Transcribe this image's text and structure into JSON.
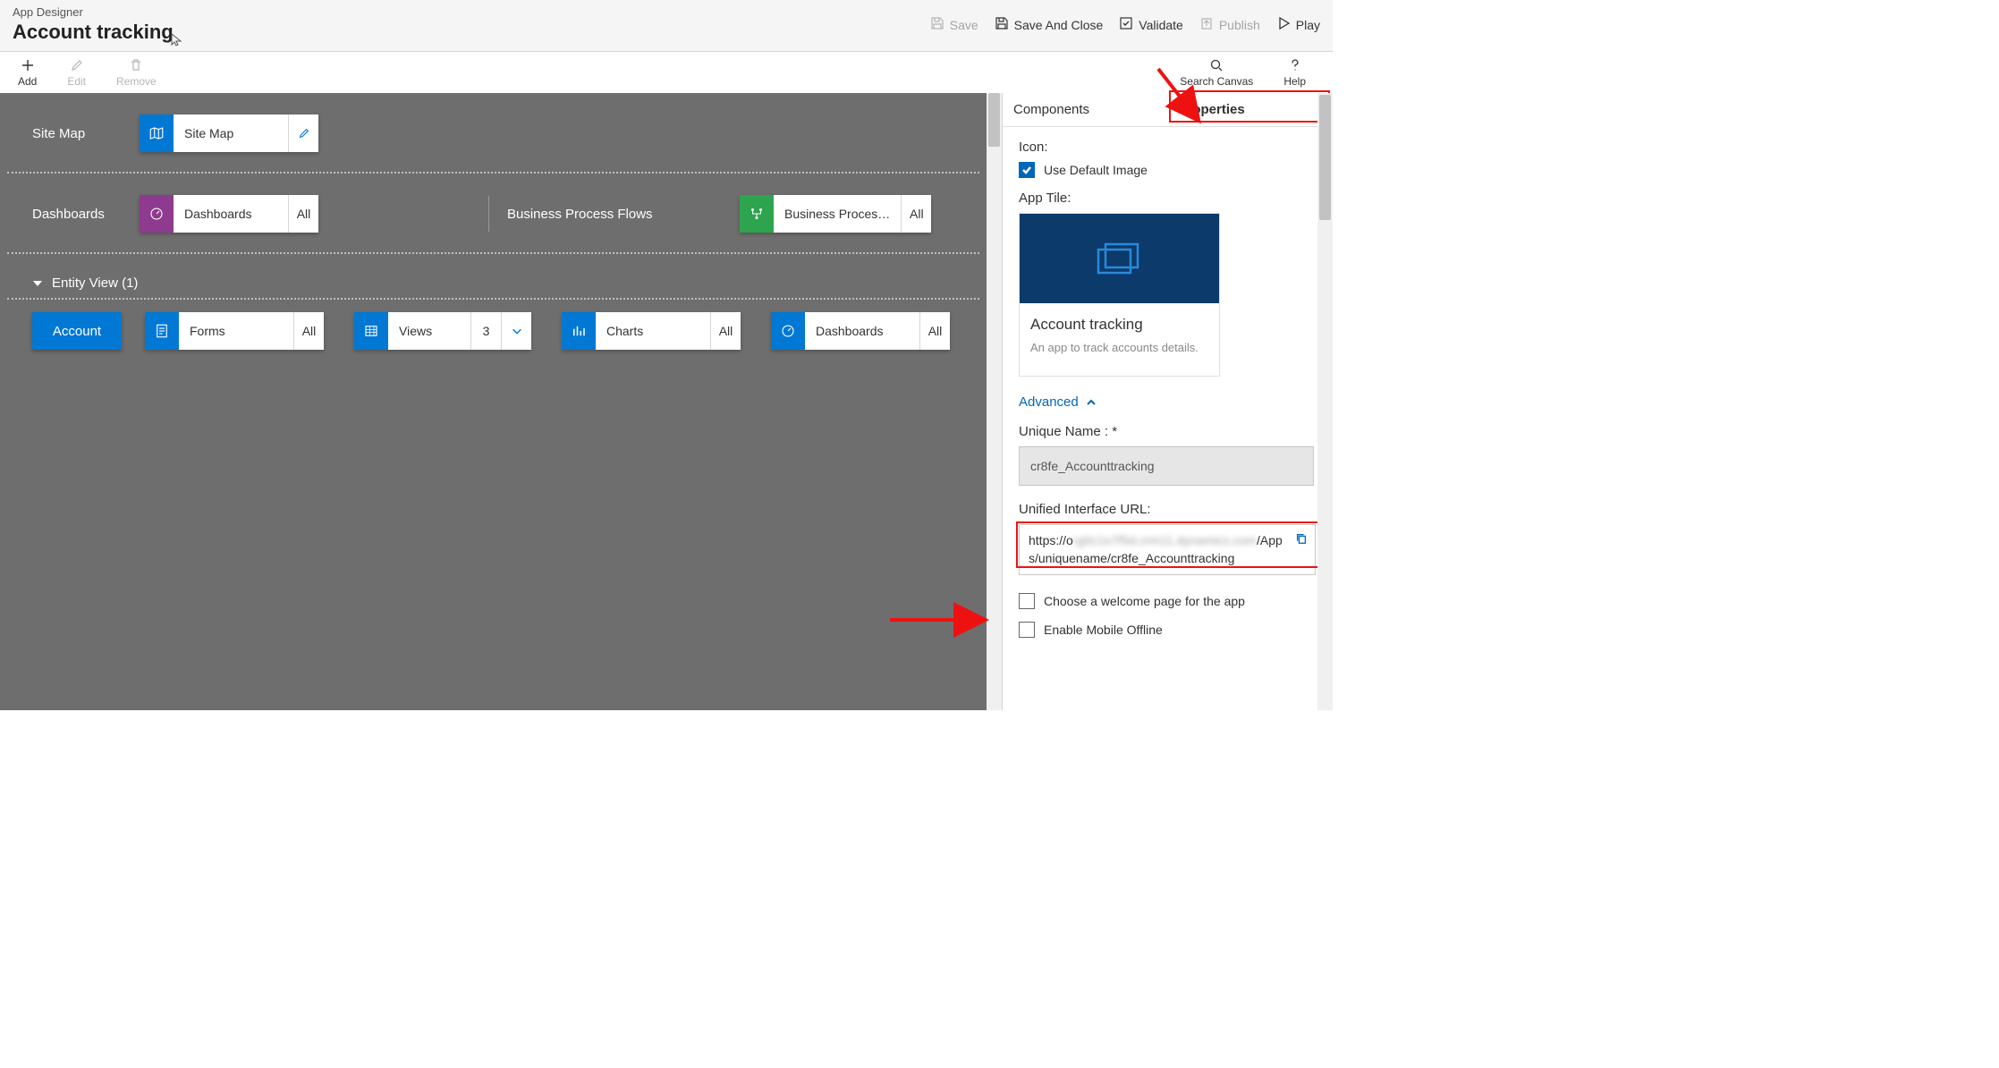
{
  "header": {
    "subtitle": "App Designer",
    "title": "Account tracking",
    "buttons": {
      "save": "Save",
      "save_close": "Save And Close",
      "validate": "Validate",
      "publish": "Publish",
      "play": "Play"
    }
  },
  "toolbar": {
    "add": "Add",
    "edit": "Edit",
    "remove": "Remove",
    "search": "Search Canvas",
    "help": "Help"
  },
  "canvas": {
    "sitemap": {
      "label": "Site Map",
      "tile": "Site Map"
    },
    "dashboards": {
      "label": "Dashboards",
      "tile": "Dashboards",
      "count": "All"
    },
    "bpf": {
      "label": "Business Process Flows",
      "tile": "Business Proces…",
      "count": "All"
    },
    "entity_view": "Entity View (1)",
    "entity": {
      "name": "Account",
      "forms": {
        "label": "Forms",
        "count": "All"
      },
      "views": {
        "label": "Views",
        "count": "3"
      },
      "charts": {
        "label": "Charts",
        "count": "All"
      },
      "dash": {
        "label": "Dashboards",
        "count": "All"
      }
    }
  },
  "panel": {
    "tabs": {
      "components": "Components",
      "properties": "Properties"
    },
    "icon_label": "Icon:",
    "default_image": "Use Default Image",
    "app_tile_label": "App Tile:",
    "tile_title": "Account tracking",
    "tile_desc": "An app to track accounts details.",
    "advanced": "Advanced",
    "unique_name_label": "Unique Name : *",
    "unique_name_value": "cr8fe_Accounttracking",
    "url_label": "Unified Interface URL:",
    "url_prefix": "https://o",
    "url_blur": "rg0c1e7f5d.crm11.dynamics.com",
    "url_suffix": "/Apps/uniquename/cr8fe_Accounttracking",
    "welcome_page": "Choose a welcome page for the app",
    "mobile_offline": "Enable Mobile Offline"
  }
}
